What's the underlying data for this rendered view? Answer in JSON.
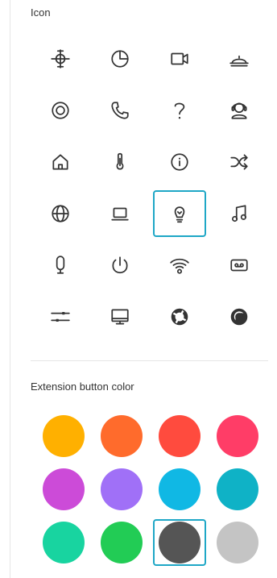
{
  "sections": {
    "icon_title": "Icon",
    "color_title": "Extension button color"
  },
  "icons": [
    {
      "name": "brightness-icon"
    },
    {
      "name": "pie-chart-icon"
    },
    {
      "name": "video-camera-icon"
    },
    {
      "name": "service-bell-icon"
    },
    {
      "name": "target-icon"
    },
    {
      "name": "phone-icon"
    },
    {
      "name": "question-icon"
    },
    {
      "name": "helpdesk-icon"
    },
    {
      "name": "home-icon"
    },
    {
      "name": "thermometer-icon"
    },
    {
      "name": "info-icon"
    },
    {
      "name": "shuffle-icon"
    },
    {
      "name": "globe-icon"
    },
    {
      "name": "laptop-icon"
    },
    {
      "name": "lightbulb-icon",
      "selected": true
    },
    {
      "name": "music-note-icon"
    },
    {
      "name": "microphone-icon"
    },
    {
      "name": "power-icon"
    },
    {
      "name": "wifi-icon"
    },
    {
      "name": "voicemail-icon"
    },
    {
      "name": "sliders-icon"
    },
    {
      "name": "monitor-icon"
    },
    {
      "name": "lifebuoy-icon"
    },
    {
      "name": "ring-icon"
    }
  ],
  "colors": [
    {
      "hex": "#FFB000"
    },
    {
      "hex": "#FF6B2C"
    },
    {
      "hex": "#FF4B3E"
    },
    {
      "hex": "#FF3D67"
    },
    {
      "hex": "#CC4BD8"
    },
    {
      "hex": "#A070F7"
    },
    {
      "hex": "#10B8E4"
    },
    {
      "hex": "#0FB2C6"
    },
    {
      "hex": "#18D4A0"
    },
    {
      "hex": "#22CC55"
    },
    {
      "hex": "#555555",
      "selected": true
    },
    {
      "hex": "#C4C4C4"
    }
  ]
}
